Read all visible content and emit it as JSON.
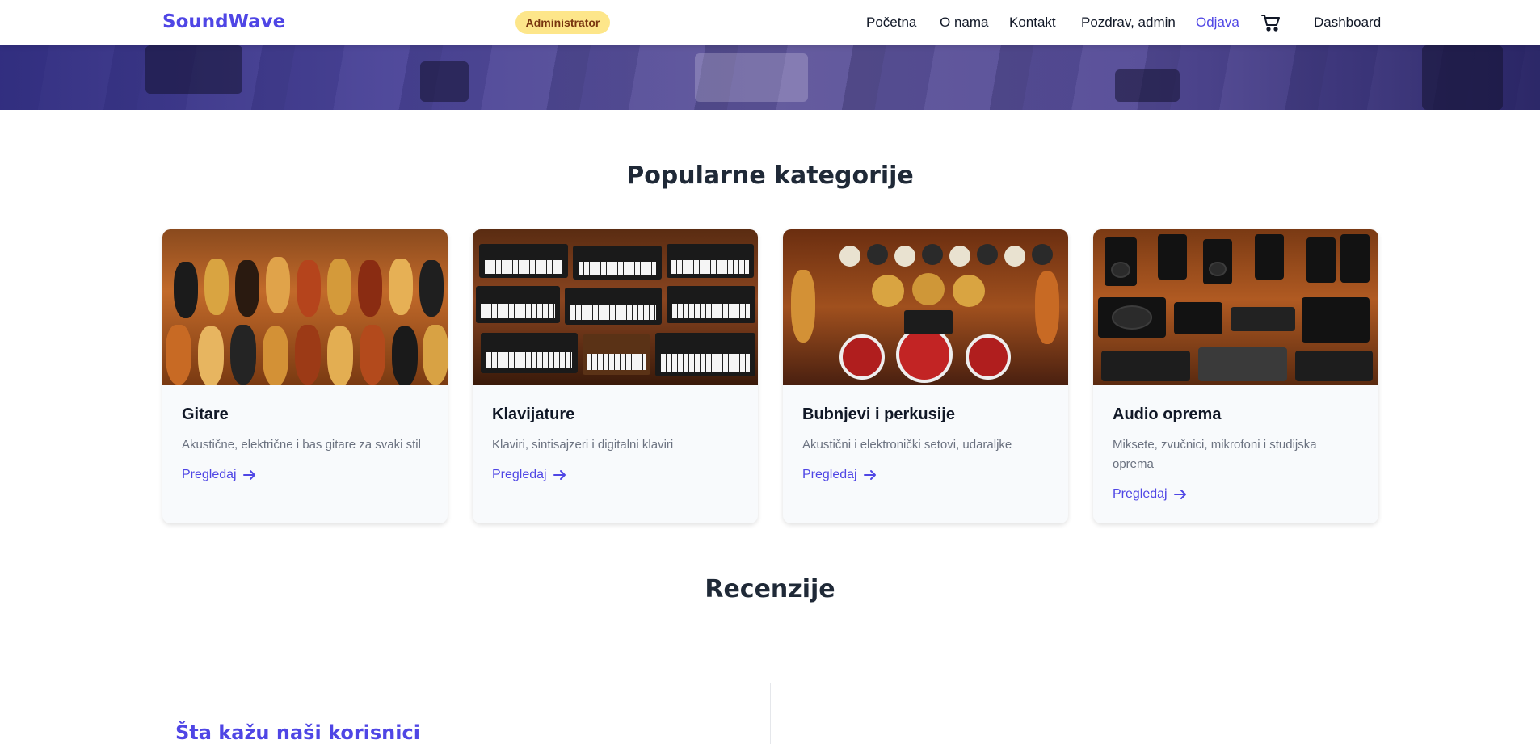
{
  "header": {
    "brand": "SoundWave",
    "role_badge": "Administrator",
    "nav": {
      "home": "Početna",
      "about": "O nama",
      "contact": "Kontakt",
      "greeting": "Pozdrav, admin",
      "logout": "Odjava",
      "dashboard": "Dashboard"
    },
    "cart_icon": "shopping-cart-icon"
  },
  "categories": {
    "title": "Popularne kategorije",
    "items": [
      {
        "title": "Gitare",
        "description": "Akustične, električne i bas gitare za svaki stil",
        "link": "Pregledaj"
      },
      {
        "title": "Klavijature",
        "description": "Klaviri, sintisajzeri i digitalni klaviri",
        "link": "Pregledaj"
      },
      {
        "title": "Bubnjevi i perkusije",
        "description": "Akustični i elektronički setovi, udaraljke",
        "link": "Pregledaj"
      },
      {
        "title": "Audio oprema",
        "description": "Miksete, zvučnici, mikrofoni i studijska oprema",
        "link": "Pregledaj"
      }
    ]
  },
  "reviews": {
    "title": "Recenzije",
    "subtitle": "Šta kažu naši korisnici"
  },
  "colors": {
    "brand": "#4f46e5",
    "badge_bg": "#fde68a",
    "badge_text": "#78350f",
    "heading": "#1f2937"
  }
}
